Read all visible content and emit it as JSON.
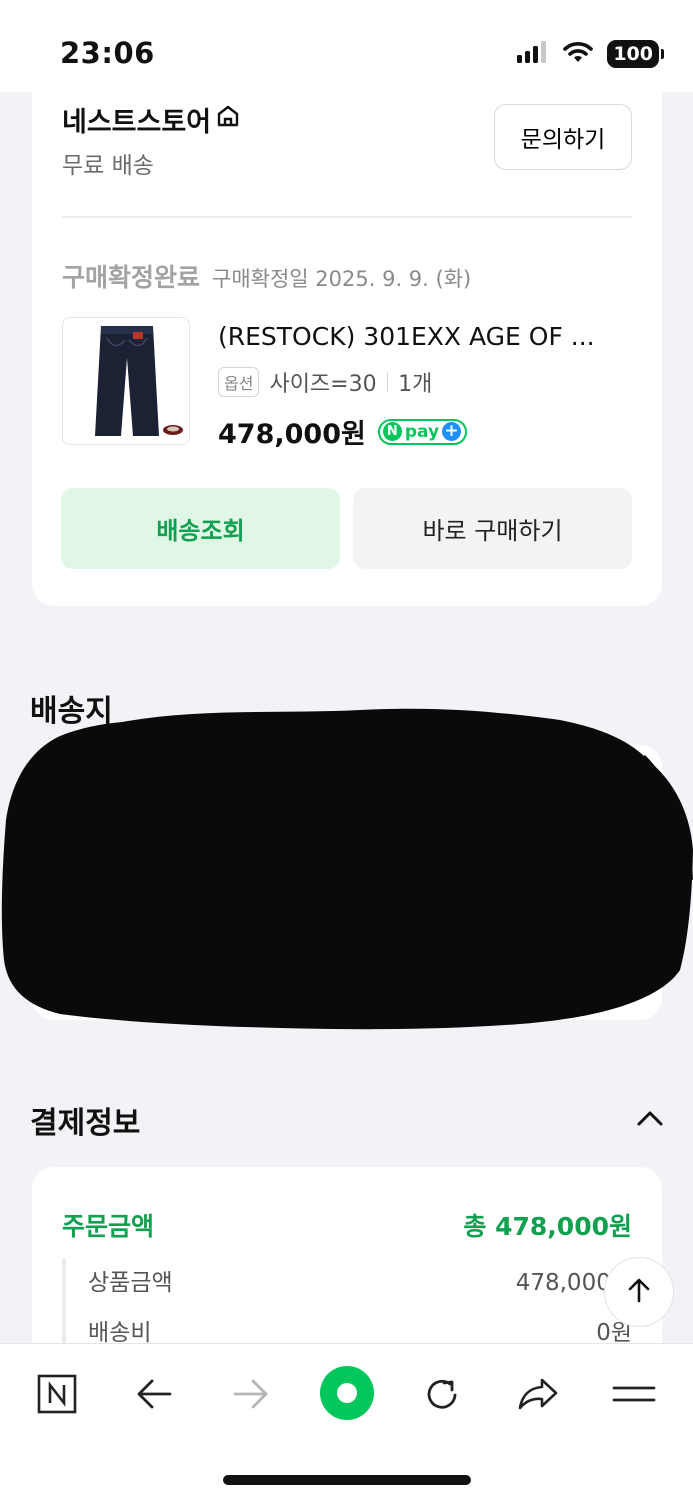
{
  "status_bar": {
    "time": "23:06",
    "battery": "100"
  },
  "store": {
    "name": "네스트스토어",
    "shipping": "무료 배송",
    "inquiry_label": "문의하기"
  },
  "order": {
    "status": "구매확정완료",
    "confirm_date": "구매확정일 2025. 9. 9. (화)",
    "product_name": "(RESTOCK) 301EXX AGE OF ...",
    "option_tag": "옵션",
    "option_value": "사이즈=30",
    "quantity": "1개",
    "price": "478,000원",
    "npay_label": "pay",
    "track_button": "배송조회",
    "buy_again_button": "바로 구매하기"
  },
  "shipping_section": {
    "title": "배송지"
  },
  "payment_section": {
    "title": "결제정보",
    "order_amount_label": "주문금액",
    "order_amount_total": "총 478,000원",
    "rows": [
      {
        "label": "상품금액",
        "value": "478,000원"
      },
      {
        "label": "배송비",
        "value": "0원"
      }
    ]
  },
  "colors": {
    "accent": "#03c75a",
    "accent_text": "#10a050",
    "track_bg": "#e0f7e6"
  }
}
